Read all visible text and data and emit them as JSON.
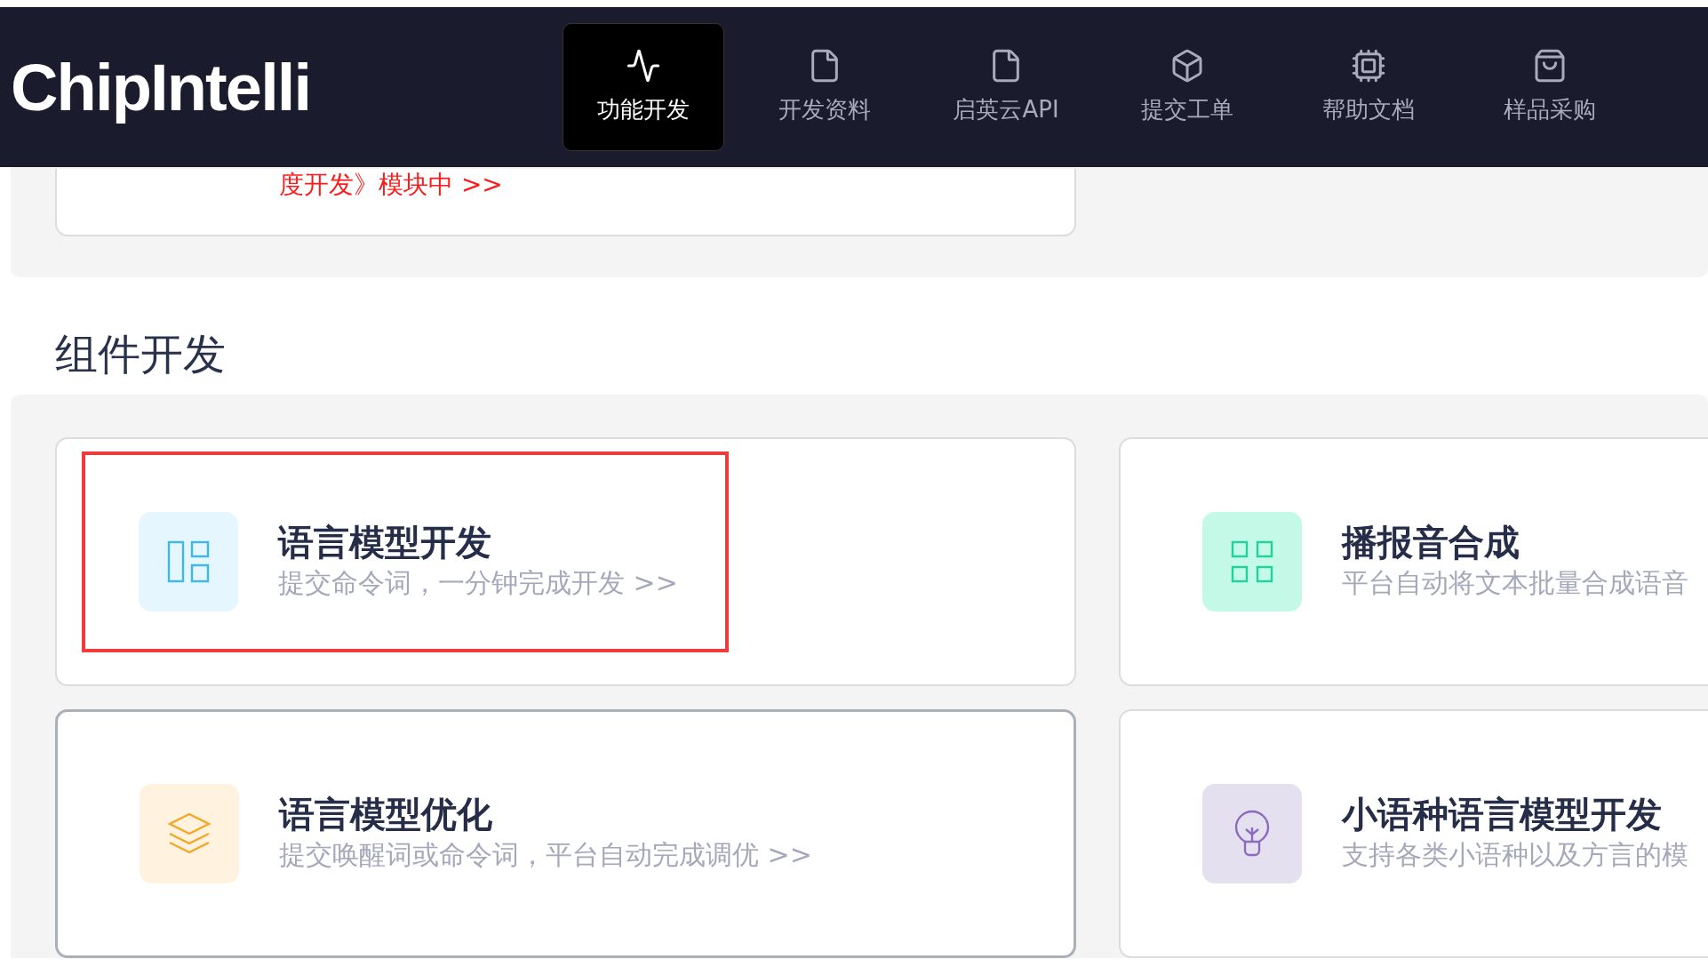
{
  "header": {
    "logo": "ChipIntelli",
    "nav": [
      {
        "label": "功能开发",
        "selected": true
      },
      {
        "label": "开发资料",
        "selected": false
      },
      {
        "label": "启英云API",
        "selected": false
      },
      {
        "label": "提交工单",
        "selected": false
      },
      {
        "label": "帮助文档",
        "selected": false
      },
      {
        "label": "样品采购",
        "selected": false
      }
    ]
  },
  "top_card": {
    "link": "度开发》模块中 >>"
  },
  "section": {
    "title": "组件开发",
    "cards": [
      {
        "title": "语言模型开发",
        "subtitle": "提交命令词，一分钟完成开发 >>",
        "color": "#e6f6fe",
        "annotated": true,
        "selected": false
      },
      {
        "title": "播报音合成",
        "subtitle": "平台自动将文本批量合成语音",
        "color": "#c4f9e8",
        "annotated": false,
        "selected": false
      },
      {
        "title": "语言模型优化",
        "subtitle": "提交唤醒词或命令词，平台自动完成调优 >>",
        "color": "#fff2df",
        "annotated": false,
        "selected": true
      },
      {
        "title": "小语种语言模型开发",
        "subtitle": "支持各类小语种以及方言的模",
        "color": "#e5e0ef",
        "annotated": false,
        "selected": false
      }
    ]
  }
}
